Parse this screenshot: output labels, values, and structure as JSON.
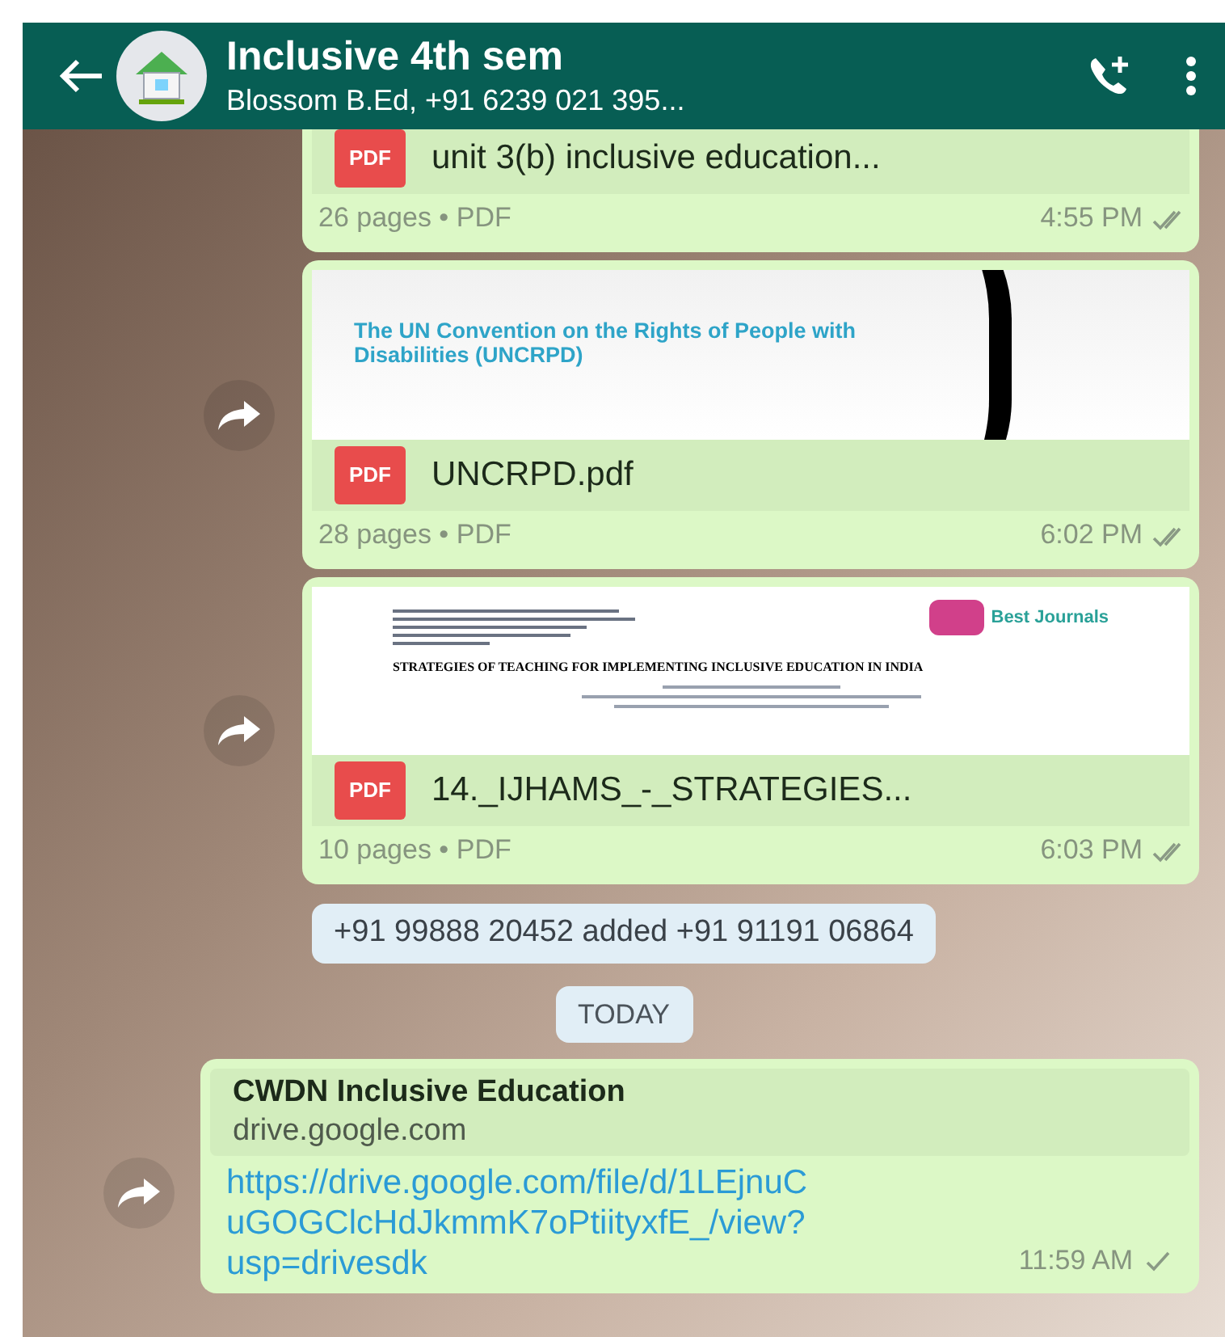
{
  "header": {
    "title": "Inclusive 4th sem",
    "subtitle": "Blossom B.Ed, +91 6239 021 395..."
  },
  "messages": [
    {
      "kind": "document",
      "file_name": "unit 3(b) inclusive education...",
      "file_type": "PDF",
      "meta": "26 pages • PDF",
      "time": "4:55 PM",
      "delivered": true,
      "forwardable": false
    },
    {
      "kind": "document",
      "preview": {
        "kind": "slide",
        "heading": "The UN Convention on the Rights of People with Disabilities (UNCRPD)"
      },
      "file_name": "UNCRPD.pdf",
      "file_type": "PDF",
      "meta": "28 pages • PDF",
      "time": "6:02 PM",
      "delivered": true,
      "forwardable": true
    },
    {
      "kind": "document",
      "preview": {
        "kind": "paper",
        "heading": "STRATEGIES OF TEACHING FOR IMPLEMENTING INCLUSIVE EDUCATION IN INDIA",
        "logo": "Best Journals"
      },
      "file_name": "14._IJHAMS_-_STRATEGIES...",
      "file_type": "PDF",
      "meta": "10 pages • PDF",
      "time": "6:03 PM",
      "delivered": true,
      "forwardable": true
    },
    {
      "kind": "system",
      "text": "+91 99888 20452 added +91 91191 06864"
    },
    {
      "kind": "date",
      "text": "TODAY"
    },
    {
      "kind": "link",
      "title": "CWDN Inclusive Education",
      "domain": "drive.google.com",
      "url": "https://drive.google.com/file/d/1LEjnuCuGOGClcHdJkmmK7oPtiityxfE_/view?usp=drivesdk",
      "time": "11:59 AM",
      "delivered": false,
      "forwardable": true
    }
  ]
}
